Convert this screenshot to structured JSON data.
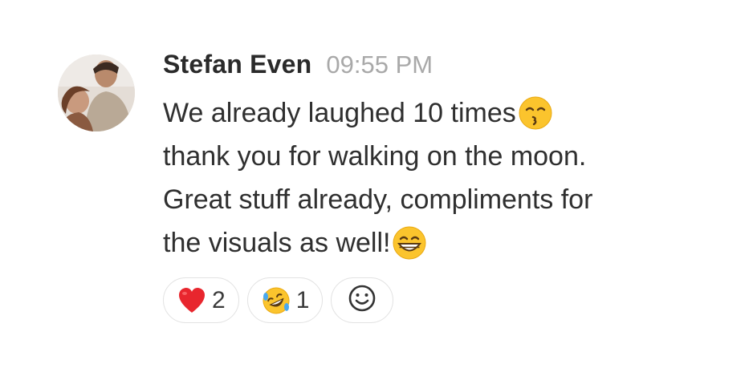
{
  "message": {
    "author": "Stefan Even",
    "timestamp": "09:55 PM",
    "lines": [
      "We already laughed 10 times",
      "thank you for walking on the moon.",
      "Great stuff already, compliments for",
      "the visuals as well!"
    ],
    "inline_emojis": {
      "line1": "kissing-smiling-eyes-emoji",
      "line4": "grinning-emoji"
    }
  },
  "reactions": [
    {
      "emoji": "heart-emoji",
      "count": "2"
    },
    {
      "emoji": "rofl-emoji",
      "count": "1"
    }
  ],
  "add_reaction": {
    "icon": "smiley-add-icon"
  },
  "colors": {
    "text": "#2f2f2f",
    "timestamp": "#a9a9a9",
    "border": "#e2e2e2",
    "emoji_yellow": "#fbc42d",
    "heart_red": "#e8262e"
  }
}
